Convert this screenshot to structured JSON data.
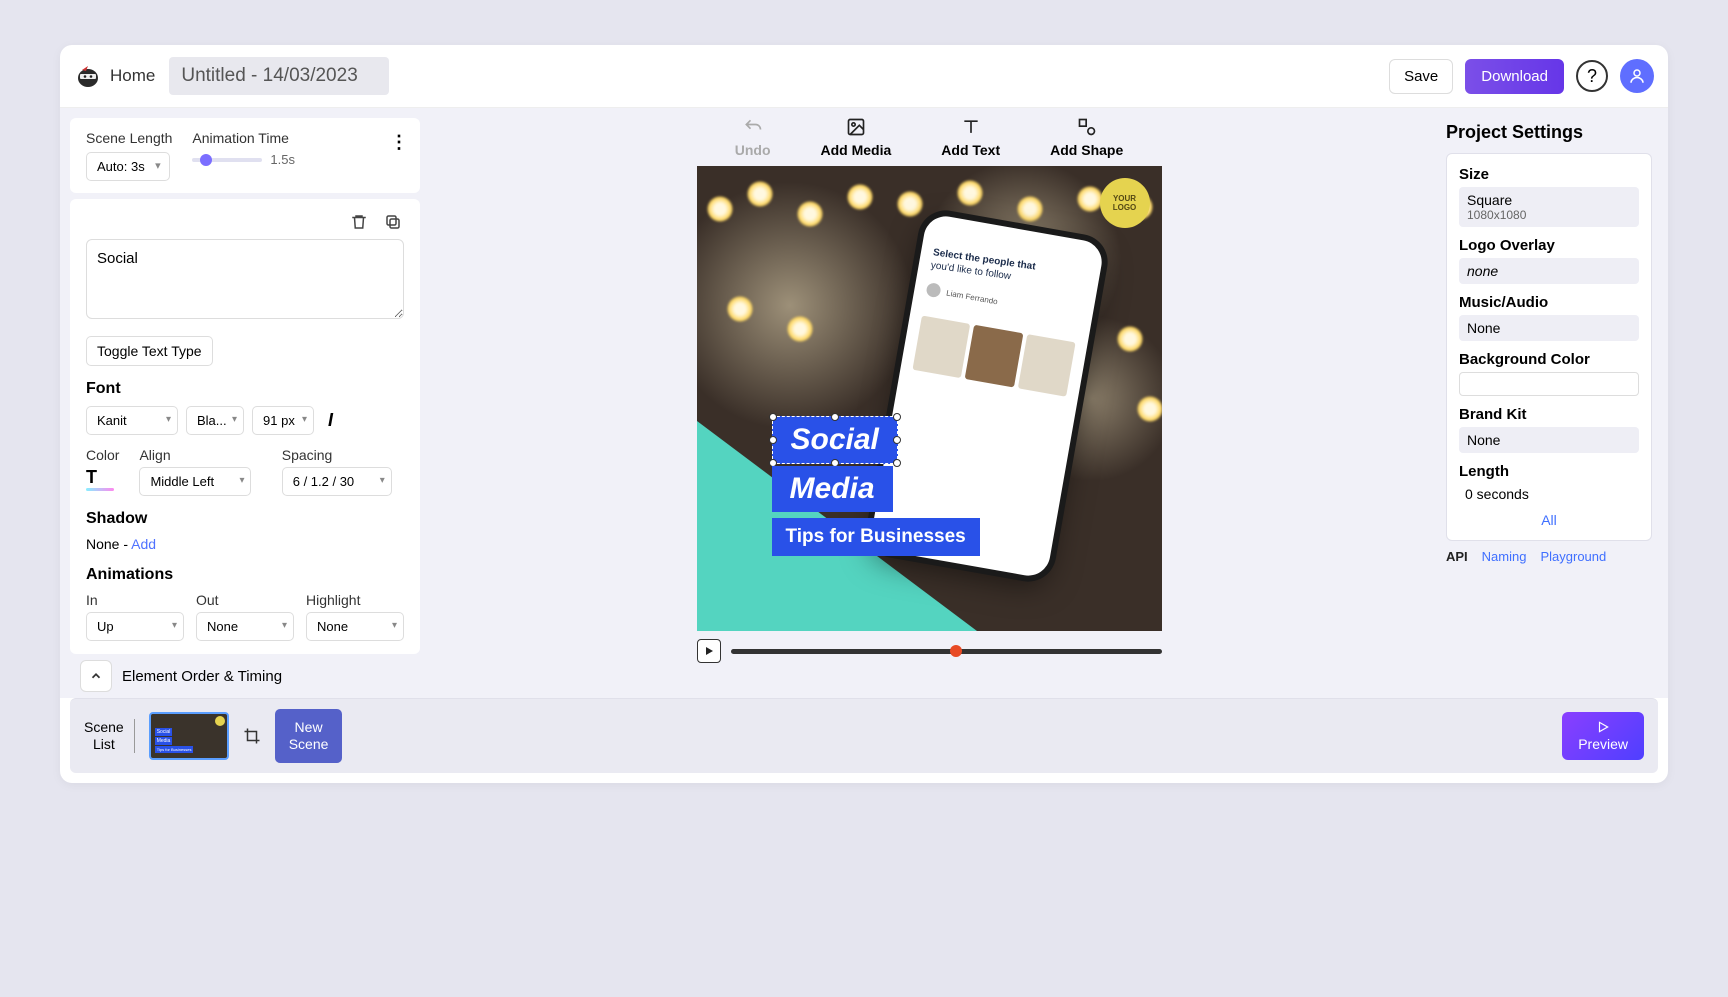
{
  "header": {
    "home": "Home",
    "title": "Untitled - 14/03/2023",
    "save": "Save",
    "download": "Download"
  },
  "sceneLength": {
    "label": "Scene Length",
    "value": "Auto: 3s"
  },
  "animationTime": {
    "label": "Animation Time",
    "value": "1.5s"
  },
  "editor": {
    "textValue": "Social",
    "toggleTextType": "Toggle Text Type",
    "fontLabel": "Font",
    "fontFamily": "Kanit",
    "fontWeight": "Bla...",
    "fontSize": "91",
    "fontUnit": "px",
    "colorLabel": "Color",
    "alignLabel": "Align",
    "alignValue": "Middle Left",
    "spacingLabel": "Spacing",
    "spacingValue": "6 / 1.2 / 30",
    "shadowLabel": "Shadow",
    "shadowValue": "None - ",
    "shadowAdd": "Add",
    "animationsLabel": "Animations",
    "animIn": "In",
    "animInVal": "Up",
    "animOut": "Out",
    "animOutVal": "None",
    "animHighlight": "Highlight",
    "animHighlightVal": "None",
    "elementOrder": "Element Order & Timing"
  },
  "toolbar": {
    "undo": "Undo",
    "addMedia": "Add Media",
    "addText": "Add Text",
    "addShape": "Add Shape"
  },
  "canvas": {
    "logoLine1": "YOUR",
    "logoLine2": "LOGO",
    "phone1": "Select the people that",
    "phone2": "you'd like to follow",
    "phoneName": "Liam Ferrando",
    "text1": "Social",
    "text2": "Media",
    "text3": "Tips for Businesses"
  },
  "settings": {
    "title": "Project Settings",
    "sizeLabel": "Size",
    "sizeValue": "Square",
    "sizeSub": "1080x1080",
    "logoLabel": "Logo Overlay",
    "logoValue": "none",
    "musicLabel": "Music/Audio",
    "musicValue": "None",
    "bgLabel": "Background Color",
    "brandLabel": "Brand Kit",
    "brandValue": "None",
    "lengthLabel": "Length",
    "lengthValue": "0 seconds",
    "all": "All",
    "api": "API",
    "naming": "Naming",
    "playground": "Playground"
  },
  "footer": {
    "sceneList": "Scene\nList",
    "newScene": "New\nScene",
    "preview": "Preview"
  }
}
